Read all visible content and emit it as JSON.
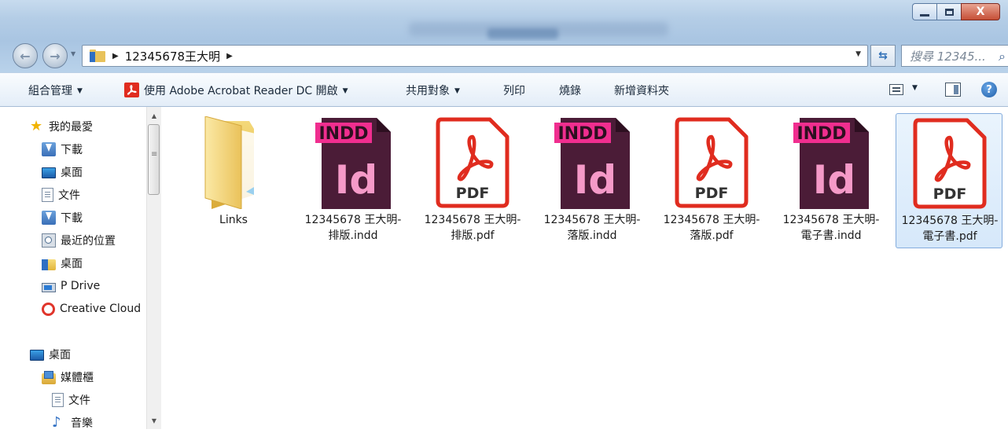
{
  "window": {
    "minimize_label": "",
    "maximize_label": "",
    "close_label": "X"
  },
  "address": {
    "path": "12345678王大明",
    "search_placeholder": "搜尋 12345..."
  },
  "toolbar": {
    "organize": "組合管理",
    "open_with": "使用 Adobe Acrobat Reader DC 開啟",
    "share": "共用對象",
    "print": "列印",
    "burn": "燒錄",
    "new_folder": "新增資料夾"
  },
  "sidebar": {
    "favorites": {
      "label": "我的最愛",
      "items": [
        {
          "label": "下載",
          "icon": "downloads-icon"
        },
        {
          "label": "桌面",
          "icon": "desktop-icon"
        },
        {
          "label": "文件",
          "icon": "document-icon"
        },
        {
          "label": "下載",
          "icon": "downloads-icon"
        },
        {
          "label": "最近的位置",
          "icon": "recent-places-icon"
        },
        {
          "label": "桌面",
          "icon": "folder-icon"
        },
        {
          "label": "P Drive",
          "icon": "network-drive-icon"
        },
        {
          "label": "Creative Cloud",
          "icon": "creative-cloud-icon"
        }
      ]
    },
    "desktop": {
      "label": "桌面",
      "items": [
        {
          "label": "媒體櫃",
          "icon": "library-icon"
        },
        {
          "label": "文件",
          "icon": "document-icon"
        },
        {
          "label": "音樂",
          "icon": "music-icon"
        }
      ]
    }
  },
  "files": [
    {
      "name": "Links",
      "type": "folder"
    },
    {
      "name": "12345678 王大明-排版.indd",
      "type": "indd",
      "badge": "INDD",
      "glyph": "Id"
    },
    {
      "name": "12345678 王大明-排版.pdf",
      "type": "pdf",
      "glyph": "PDF"
    },
    {
      "name": "12345678 王大明-落版.indd",
      "type": "indd",
      "badge": "INDD",
      "glyph": "Id"
    },
    {
      "name": "12345678 王大明-落版.pdf",
      "type": "pdf",
      "glyph": "PDF"
    },
    {
      "name": "12345678 王大明-電子書.indd",
      "type": "indd",
      "badge": "INDD",
      "glyph": "Id"
    },
    {
      "name": "12345678 王大明-電子書.pdf",
      "type": "pdf",
      "glyph": "PDF",
      "selected": true
    }
  ],
  "colors": {
    "indd_dark": "#4b1c37",
    "indd_pink": "#f02e8f",
    "pdf_red": "#e02c1f",
    "selection": "#d6e8fa"
  }
}
